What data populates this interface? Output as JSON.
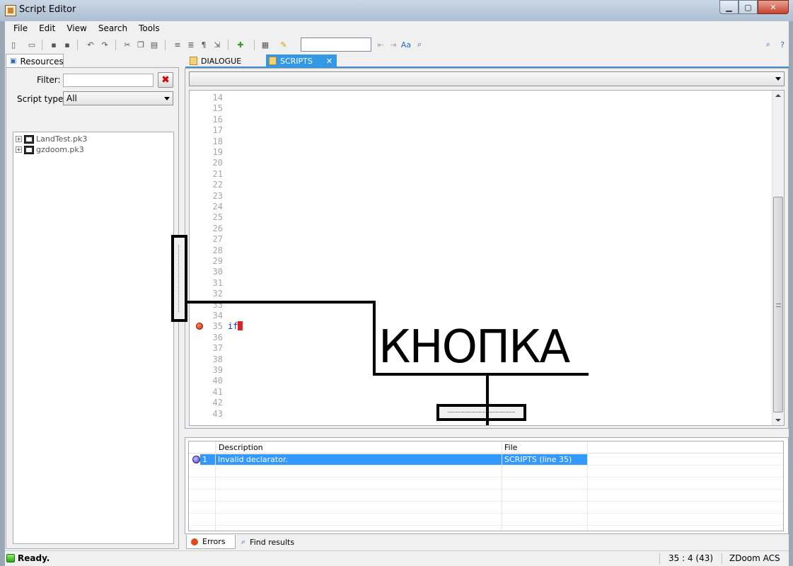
{
  "window": {
    "title": "Script Editor",
    "minimize": "▁",
    "maximize": "▢",
    "close": "✕"
  },
  "menu": [
    "File",
    "Edit",
    "View",
    "Search",
    "Tools"
  ],
  "left": {
    "tab_label": "Resources",
    "filter_label": "Filter:",
    "filter_value": "",
    "clear_icon": "✖",
    "script_type_label": "Script type:",
    "script_type_value": "All",
    "tree": [
      {
        "label": "LandTest.pk3"
      },
      {
        "label": "gzdoom.pk3"
      }
    ]
  },
  "doc_tabs": [
    {
      "label": "DIALOGUE",
      "active": false
    },
    {
      "label": "SCRIPTS",
      "active": true,
      "close": "✕"
    }
  ],
  "editor": {
    "proc_select": "",
    "lines": [
      "14",
      "15",
      "16",
      "17",
      "18",
      "19",
      "20",
      "21",
      "22",
      "23",
      "24",
      "25",
      "26",
      "27",
      "28",
      "29",
      "30",
      "31",
      "32",
      "33",
      "34",
      "35",
      "36",
      "37",
      "38",
      "39",
      "40",
      "41",
      "42",
      "43"
    ],
    "error_line": "35",
    "code_text": "if"
  },
  "annotation": {
    "label": "КНОПКА"
  },
  "errors": {
    "columns": [
      "Description",
      "File"
    ],
    "rows": [
      {
        "num": "1",
        "description": "Invalid declarator.",
        "file": "SCRIPTS (line 35)"
      }
    ]
  },
  "bottom_tabs": [
    "Errors",
    "Find results"
  ],
  "status": {
    "text": "Ready.",
    "position": "35 : 4 (43)",
    "language": "ZDoom ACS"
  },
  "colors": {
    "accent": "#3399e6",
    "selection": "#3399ff",
    "error": "#c82800"
  }
}
